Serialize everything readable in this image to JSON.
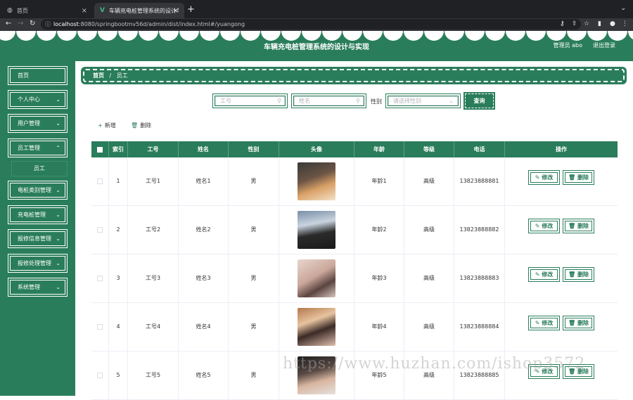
{
  "browser": {
    "tabs": [
      {
        "title": "首页"
      },
      {
        "title": "车辆充电桩管理系统的设计与实现"
      }
    ],
    "url_host": "localhost",
    "url_rest": ":8080/springbootmv56d/admin/dist/index.html#/yuangong"
  },
  "header": {
    "title": "车辆充电桩管理系统的设计与实现",
    "user": "管理员 abo",
    "logout": "退出登录"
  },
  "sidebar": {
    "items": [
      {
        "label": "首页",
        "chev": false
      },
      {
        "label": "个人中心",
        "chev": true
      },
      {
        "label": "用户管理",
        "chev": true
      },
      {
        "label": "员工管理",
        "chev": true
      },
      {
        "label": "电桩类别管理",
        "chev": true
      },
      {
        "label": "充电桩管理",
        "chev": true
      },
      {
        "label": "报修信息管理",
        "chev": true
      },
      {
        "label": "报修处理管理",
        "chev": true
      },
      {
        "label": "系统管理",
        "chev": true
      }
    ],
    "submenu": "员工"
  },
  "breadcrumb": {
    "home": "首页",
    "sep": "/",
    "current": "员工"
  },
  "search": {
    "id_placeholder": "工号",
    "name_placeholder": "姓名",
    "gender_label": "性别",
    "gender_placeholder": "请选择性别",
    "query": "查询"
  },
  "actions": {
    "add": "新增",
    "delete": "删除"
  },
  "table": {
    "headers": [
      "",
      "索引",
      "工号",
      "姓名",
      "性别",
      "头像",
      "年龄",
      "等级",
      "电话",
      "操作"
    ],
    "rows": [
      {
        "index": "1",
        "id": "工号1",
        "name": "姓名1",
        "gender": "男",
        "age": "年龄1",
        "level": "高级",
        "phone": "13823888881"
      },
      {
        "index": "2",
        "id": "工号2",
        "name": "姓名2",
        "gender": "男",
        "age": "年龄2",
        "level": "高级",
        "phone": "13823888882"
      },
      {
        "index": "3",
        "id": "工号3",
        "name": "姓名3",
        "gender": "男",
        "age": "年龄3",
        "level": "高级",
        "phone": "13823888883"
      },
      {
        "index": "4",
        "id": "工号4",
        "name": "姓名4",
        "gender": "男",
        "age": "年龄4",
        "level": "高级",
        "phone": "13823888884"
      },
      {
        "index": "5",
        "id": "工号5",
        "name": "姓名5",
        "gender": "男",
        "age": "年龄5",
        "level": "高级",
        "phone": "13823888885"
      }
    ],
    "edit_label": "修改",
    "delete_label": "删除"
  },
  "watermark": "https://www.huzhan.com/ishop3572",
  "colors": {
    "brand": "#2a7d5b"
  }
}
